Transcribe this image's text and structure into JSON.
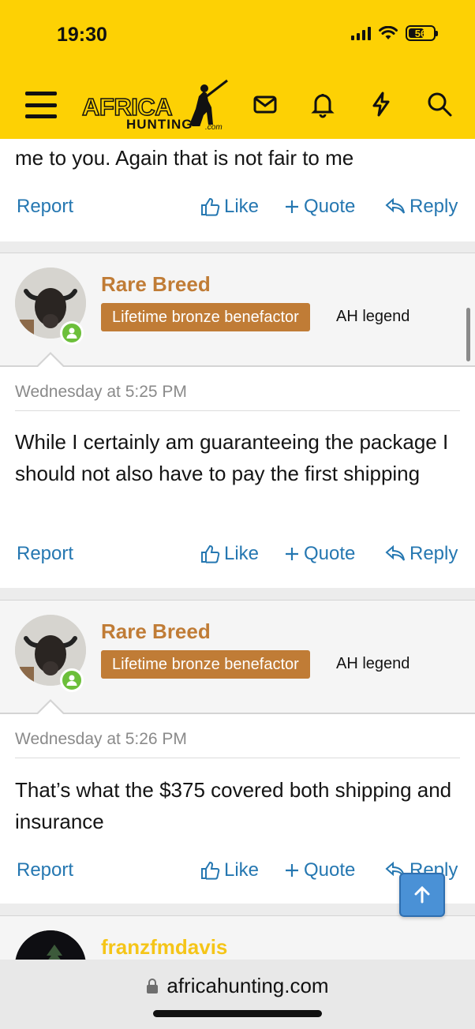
{
  "status_bar": {
    "time": "19:30",
    "battery": "56"
  },
  "header": {
    "logo": {
      "line1": "AFRICA",
      "line2": "HUNTING",
      "suffix": ".com"
    },
    "brand_color": "#fdd104",
    "icons": [
      "menu-icon",
      "mail-icon",
      "bell-icon",
      "lightning-icon",
      "search-icon"
    ]
  },
  "actions": {
    "report": "Report",
    "like": "Like",
    "quote": "Quote",
    "reply": "Reply"
  },
  "previous_post": {
    "text_tail": "me to you. Again that is not fair to me"
  },
  "posts": [
    {
      "username": "Rare Breed",
      "banner": "Lifetime bronze benefactor",
      "user_title": "AH legend",
      "date": "Wednesday at 5:25 PM",
      "body": "While I certainly am guaranteeing the package I should not also have to pay the first shipping"
    },
    {
      "username": "Rare Breed",
      "banner": "Lifetime bronze benefactor",
      "user_title": "AH legend",
      "date": "Wednesday at 5:26 PM",
      "body": "That’s what the $375 covered both shipping and insurance"
    },
    {
      "username": "franzfmdavis"
    }
  ],
  "colors": {
    "link": "#2577b1",
    "username": "#c07c36",
    "banner_bg": "#c07c36",
    "next_username": "#f5c518",
    "online": "#6cbf3a"
  },
  "browser": {
    "url": "africahunting.com"
  }
}
